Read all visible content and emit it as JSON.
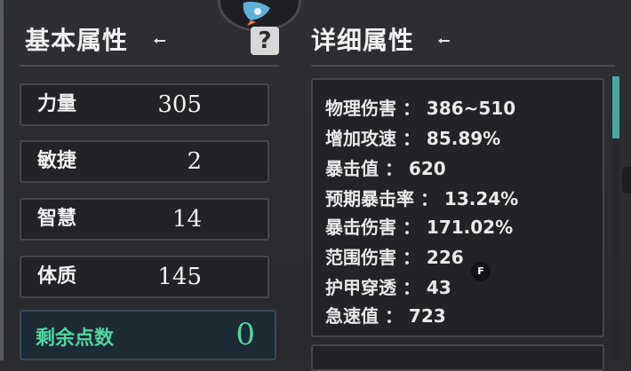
{
  "left_panel": {
    "title": "基本属性",
    "help_glyph": "?",
    "stats": [
      {
        "label": "力量",
        "value": "305"
      },
      {
        "label": "敏捷",
        "value": "2"
      },
      {
        "label": "智慧",
        "value": "14"
      },
      {
        "label": "体质",
        "value": "145"
      }
    ],
    "remaining_points": {
      "label": "剩余点数",
      "value": "0"
    }
  },
  "right_panel": {
    "title": "详细属性",
    "lines": [
      "物理伤害 ： 386~510",
      "增加攻速 ： 85.89%",
      "暴击值 ： 620",
      "预期暴击率 ： 13.24%",
      "暴击伤害 ： 171.02%",
      "范围伤害 ： 226",
      "护甲穿透 ： 43",
      "急速值 ： 723"
    ]
  },
  "hotkey_badge": "F",
  "colors": {
    "accent_green": "#4fd6a0",
    "scroll_thumb": "#4aa8a4",
    "background": "#2b2c30"
  }
}
